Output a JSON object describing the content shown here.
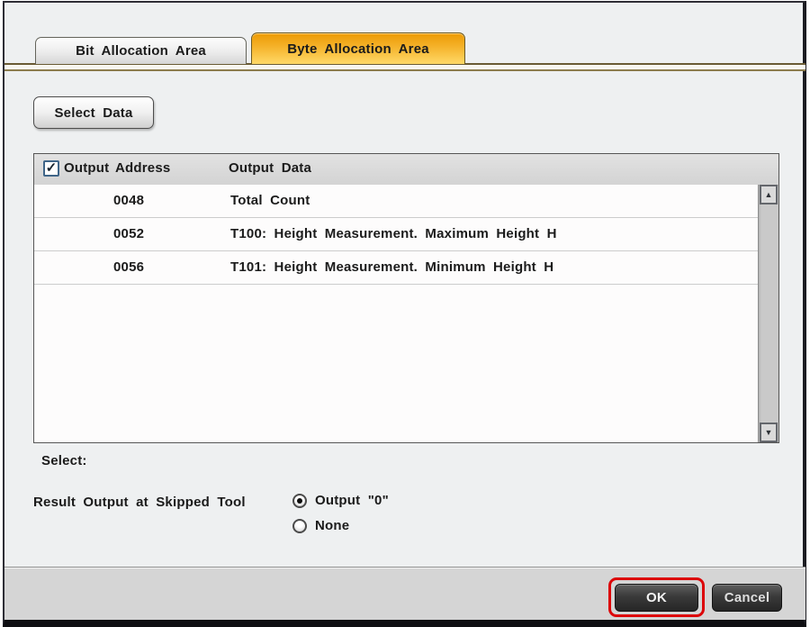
{
  "tabs": [
    {
      "label": "Bit Allocation Area",
      "active": false
    },
    {
      "label": "Byte Allocation Area",
      "active": true
    }
  ],
  "buttons": {
    "select_data": "Select Data",
    "ok": "OK",
    "cancel": "Cancel"
  },
  "table": {
    "columns": [
      "Output",
      "Address",
      "Output Data"
    ],
    "header_checkbox_checked": true,
    "rows": [
      {
        "output_checked": false,
        "address": "0048",
        "output_data": "Total Count"
      },
      {
        "output_checked": false,
        "address": "0052",
        "output_data": "T100: Height Measurement. Maximum Height H"
      },
      {
        "output_checked": false,
        "address": "0056",
        "output_data": "T101: Height Measurement. Minimum Height H"
      }
    ]
  },
  "labels": {
    "select": "Select:",
    "skipped_tool": "Result Output at Skipped Tool"
  },
  "radio_options": [
    {
      "label": "Output \"0\"",
      "selected": true
    },
    {
      "label": "None",
      "selected": false
    }
  ],
  "icons": {
    "check": "✓",
    "scroll_up": "▲",
    "scroll_down": "▼"
  },
  "colors": {
    "tab_active_top": "#ec9a03",
    "tab_active_bottom": "#ffd968",
    "divider_brown": "#6a5b34",
    "ok_highlight_ring": "#dc0508",
    "checkbox_border": "#3f6588",
    "panel_background": "#eef0f1",
    "footer_background": "#d5d5d5"
  }
}
